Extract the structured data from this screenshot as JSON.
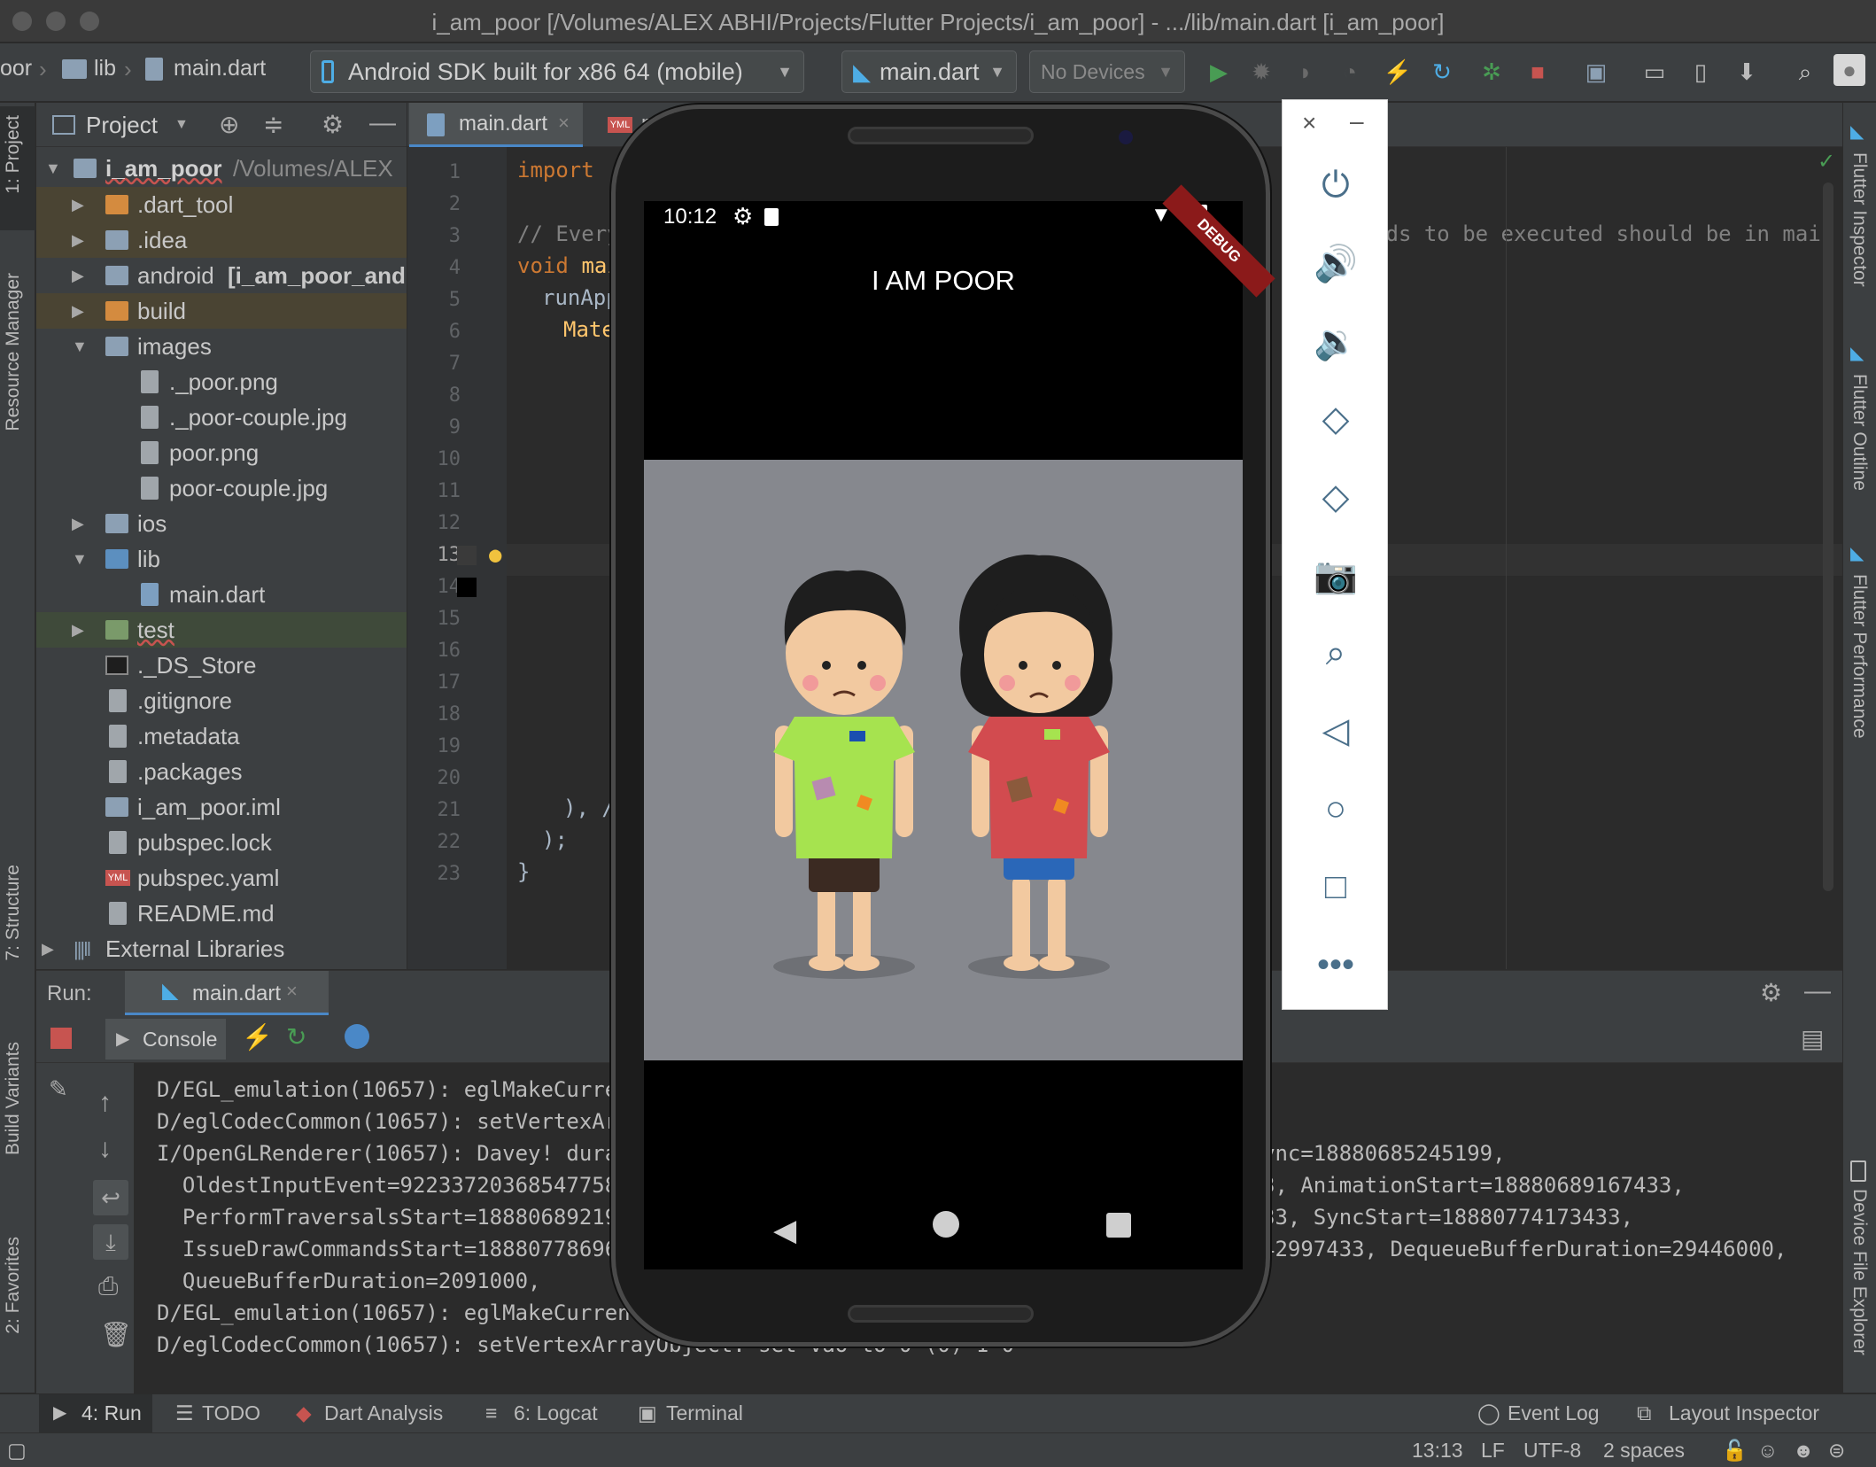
{
  "window": {
    "title": "i_am_poor [/Volumes/ALEX ABHI/Projects/Flutter Projects/i_am_poor] - .../lib/main.dart [i_am_poor]"
  },
  "toolbar": {
    "breadcrumb": [
      "oor",
      "lib",
      "main.dart"
    ],
    "device_selector": "Android SDK built for x86 64 (mobile)",
    "run_config": "main.dart",
    "no_devices": "No Devices"
  },
  "left_strip": {
    "project": "1: Project",
    "resource_manager": "Resource Manager",
    "structure": "7: Structure",
    "build_variants": "Build Variants",
    "favorites": "2: Favorites"
  },
  "right_strip": {
    "flutter_inspector": "Flutter Inspector",
    "flutter_outline": "Flutter Outline",
    "flutter_performance": "Flutter Performance",
    "device_file_explorer": "Device File Explorer"
  },
  "project_panel": {
    "title": "Project",
    "root": {
      "name": "i_am_poor",
      "path": "/Volumes/ALEX"
    },
    "items": [
      {
        "label": ".dart_tool"
      },
      {
        "label": ".idea"
      },
      {
        "label": "android",
        "suffix": "[i_am_poor_and"
      },
      {
        "label": "build"
      },
      {
        "label": "images"
      },
      {
        "label": "._poor.png"
      },
      {
        "label": "._poor-couple.jpg"
      },
      {
        "label": "poor.png"
      },
      {
        "label": "poor-couple.jpg"
      },
      {
        "label": "ios"
      },
      {
        "label": "lib"
      },
      {
        "label": "main.dart"
      },
      {
        "label": "test"
      },
      {
        "label": "._DS_Store"
      },
      {
        "label": ".gitignore"
      },
      {
        "label": ".metadata"
      },
      {
        "label": ".packages"
      },
      {
        "label": "i_am_poor.iml"
      },
      {
        "label": "pubspec.lock"
      },
      {
        "label": "pubspec.yaml"
      },
      {
        "label": "README.md"
      },
      {
        "label": "External Libraries"
      }
    ]
  },
  "editor": {
    "tabs": [
      {
        "label": "main.dart"
      },
      {
        "label": "p"
      }
    ],
    "line_numbers": [
      "1",
      "2",
      "3",
      "4",
      "5",
      "6",
      "7",
      "8",
      "9",
      "10",
      "11",
      "12",
      "13",
      "14",
      "15",
      "16",
      "17",
      "18",
      "19",
      "20",
      "21",
      "22",
      "23"
    ],
    "code": {
      "l1_kw": "import",
      "l1_str": " '",
      "l3_comment": "// Every",
      "l3_comment_right": "r       eeds to be executed should be in main",
      "l4_kw": "void",
      "l4_fn": " mai",
      "l5": "runApp",
      "l6": "Mate",
      "l21": "), /",
      "l22": ");",
      "l23": "}"
    }
  },
  "emulator": {
    "status_time": "10:12",
    "debug_banner": "DEBUG",
    "app_bar_title": "I AM POOR"
  },
  "run_panel": {
    "label": "Run:",
    "tab": "main.dart",
    "console": "Console",
    "logs": [
      "D/EGL_emulation(10657): eglMakeCurrer",
      "D/eglCodecCommon(10657): setVertexArr",
      "I/OpenGLRenderer(10657): Davey! durat",
      "  OldestInputEvent=922337203685477580",
      "  PerformTraversalsStart=188806892194",
      "  IssueDrawCommandsStart=188807786964",
      "  QueueBufferDuration=2091000,",
      "D/EGL_emulation(10657): eglMakeCurrent:",
      "D/eglCodecCommon(10657): setVertexArrayObject: set vao to 0 (0) 1 0"
    ],
    "logs_right": [
      "ync=18880685245199,",
      "3, AnimationStart=18880689167433,",
      "33, SyncStart=18880774173433,",
      "42997433, DequeueBufferDuration=29446000,"
    ]
  },
  "bottom_tabs": {
    "run": "4: Run",
    "todo": "TODO",
    "dart_analysis": "Dart Analysis",
    "logcat": "6: Logcat",
    "terminal": "Terminal",
    "event_log": "Event Log",
    "layout_inspector": "Layout Inspector"
  },
  "status_bar": {
    "position": "13:13",
    "line_sep": "LF",
    "encoding": "UTF-8",
    "indent": "2 spaces"
  },
  "colors": {
    "keyword": "#cc7832",
    "comment": "#808080",
    "accent_blue": "#4eade5",
    "run_green": "#499c54",
    "stop_red": "#c75450",
    "phone_image_bg": "#86888e"
  }
}
